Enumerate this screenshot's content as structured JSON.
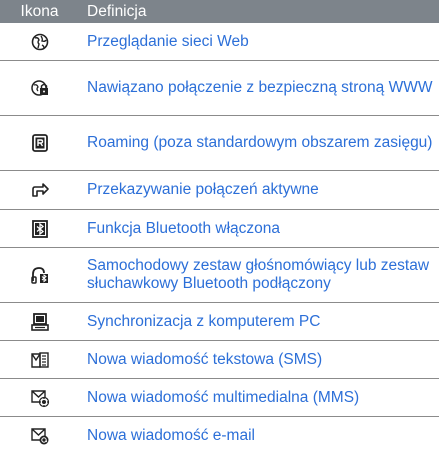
{
  "header": {
    "icon_col": "Ikona",
    "definition_col": "Definicja"
  },
  "rows": [
    {
      "icon": "web-browsing-icon",
      "text": "Przeglądanie sieci Web"
    },
    {
      "icon": "secure-connection-icon",
      "text": "Nawiązano połączenie z bezpieczną stroną WWW"
    },
    {
      "icon": "roaming-icon",
      "text": "Roaming (poza standardowym obszarem zasięgu)"
    },
    {
      "icon": "call-forwarding-icon",
      "text": "Przekazywanie połączeń aktywne"
    },
    {
      "icon": "bluetooth-icon",
      "text": "Funkcja Bluetooth włączona"
    },
    {
      "icon": "bluetooth-headset-icon",
      "text": "Samochodowy zestaw głośnomówiący lub zestaw słuchawkowy Bluetooth podłączony"
    },
    {
      "icon": "pc-sync-icon",
      "text": "Synchronizacja z komputerem PC"
    },
    {
      "icon": "sms-icon",
      "text": "Nowa wiadomość tekstowa (SMS)"
    },
    {
      "icon": "mms-icon",
      "text": "Nowa wiadomość multimedialna (MMS)"
    },
    {
      "icon": "email-icon",
      "text": "Nowa wiadomość e-mail"
    }
  ],
  "colors": {
    "header_bg": "#7d848b",
    "text": "#2c6fd8",
    "border": "#8b8b8b"
  }
}
